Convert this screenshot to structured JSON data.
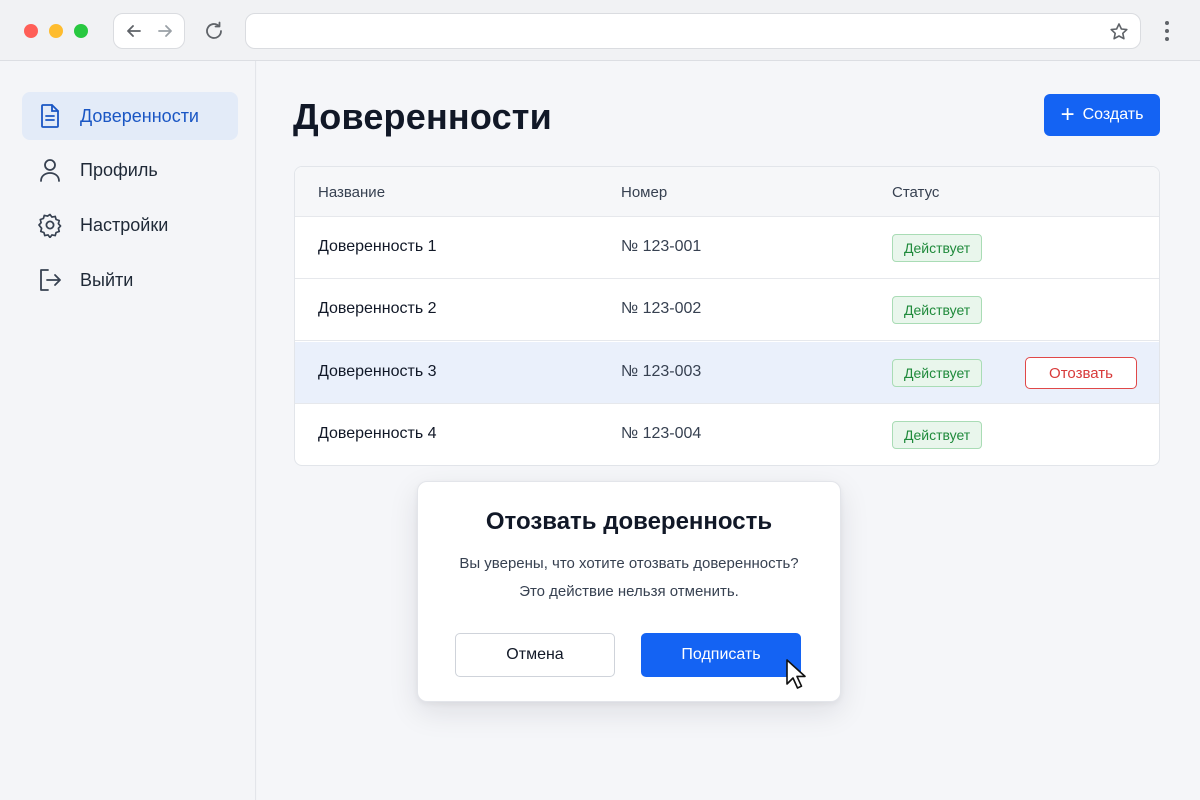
{
  "browser": {
    "address_value": "",
    "address_placeholder": ""
  },
  "sidebar": {
    "items": [
      {
        "label": "Доверенности",
        "icon": "document-icon",
        "active": true
      },
      {
        "label": "Профиль",
        "icon": "user-icon",
        "active": false
      },
      {
        "label": "Настройки",
        "icon": "gear-icon",
        "active": false
      },
      {
        "label": "Выйти",
        "icon": "logout-icon",
        "active": false
      }
    ]
  },
  "main": {
    "title": "Доверенности",
    "create_label": "Создать",
    "table": {
      "columns": [
        "Название",
        "Номер",
        "Статус"
      ],
      "rows": [
        {
          "name": "Доверенность 1",
          "number": "№ 123-001",
          "status": "Действует"
        },
        {
          "name": "Доверенность 2",
          "number": "№ 123-002",
          "status": "Действует"
        },
        {
          "name": "Доверенность 3",
          "number": "№ 123-003",
          "status": "Действует",
          "action": "Отозвать"
        },
        {
          "name": "Доверенность 4",
          "number": "№ 123-004",
          "status": "Действует"
        }
      ]
    }
  },
  "modal": {
    "title": "Отозвать доверенность",
    "line1": "Вы уверены, что хотите отозвать доверенность?",
    "line2": "Это действие нельзя отменить.",
    "cancel_label": "Отмена",
    "confirm_label": "Подписать"
  },
  "colors": {
    "accent": "#1463f3",
    "status_active": "#1f8a3b",
    "danger": "#d83a3a",
    "highlight_row": "#eaf0fb"
  }
}
